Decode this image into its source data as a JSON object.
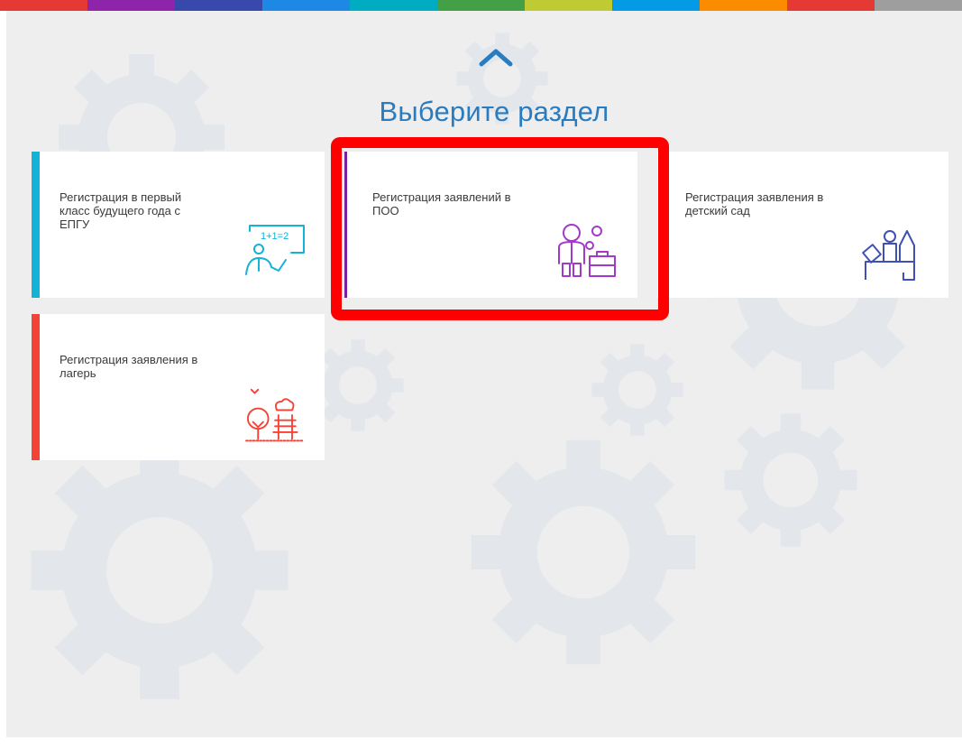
{
  "header": {
    "stripe_colors": [
      "#e53935",
      "#8e24aa",
      "#3949ab",
      "#1e88e5",
      "#00acc1",
      "#43a047",
      "#c0ca33",
      "#039be5",
      "#fb8c00",
      "#e53935",
      "#9e9e9e"
    ]
  },
  "page": {
    "title": "Выберите раздел",
    "up_icon": "chevron-up-icon"
  },
  "cards": [
    {
      "label": "Регистрация в первый класс будущего года с ЕПГУ",
      "accent": "#12b3d6",
      "icon": "teacher-board-icon"
    },
    {
      "label": "Регистрация заявлений в ПОО",
      "accent": "#7b1fa2",
      "icon": "worker-gears-icon"
    },
    {
      "label": "Регистрация заявления в детский сад",
      "accent": "#3f51b5",
      "icon": "toy-blocks-icon"
    },
    {
      "label": "Регистрация заявления в лагерь",
      "accent": "#f44336",
      "icon": "park-bench-icon"
    }
  ],
  "colors": {
    "title": "#2a7cc0",
    "highlight": "#ff0000",
    "background": "#eeeeee",
    "gear": "#e2e5e9"
  }
}
